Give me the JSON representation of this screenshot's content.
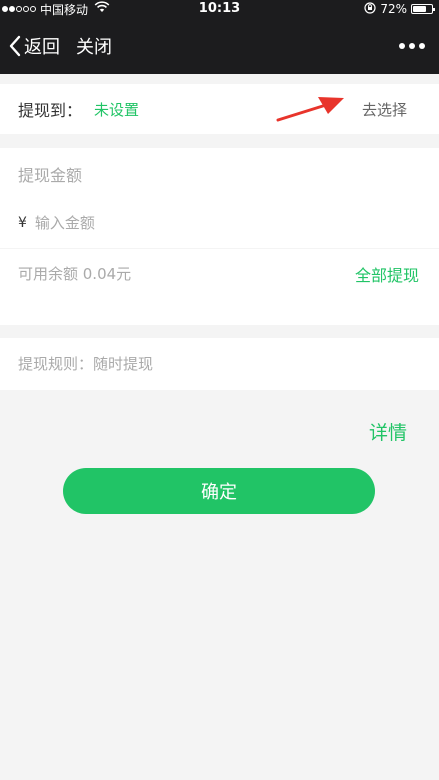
{
  "status_bar": {
    "carrier": "中国移动",
    "time": "10:13",
    "battery": "72%",
    "battery_level": 0.72,
    "signal_icon": "signal-dots-icon",
    "wifi_icon": "wifi-icon",
    "rotation_lock_icon": "rotation-lock-icon",
    "battery_icon": "battery-icon"
  },
  "nav": {
    "back_label": "返回",
    "close_label": "关闭",
    "back_icon": "chevron-left-icon",
    "more_icon": "more-dots-icon"
  },
  "target": {
    "label": "提现到：",
    "value": "未设置",
    "choose_label": "去选择"
  },
  "amount": {
    "title": "提现金额",
    "currency_symbol": "¥",
    "placeholder": "输入金额",
    "value": ""
  },
  "balance": {
    "text": "可用余额 0.04元",
    "withdraw_all_label": "全部提现"
  },
  "rules": {
    "text": "提现规则：随时提现"
  },
  "details_label": "详情",
  "confirm_label": "确定",
  "colors": {
    "accent": "#21c466",
    "nav_bg": "#1c1c1e",
    "page_bg": "#f4f4f4",
    "annotation_arrow": "#e8342b"
  }
}
